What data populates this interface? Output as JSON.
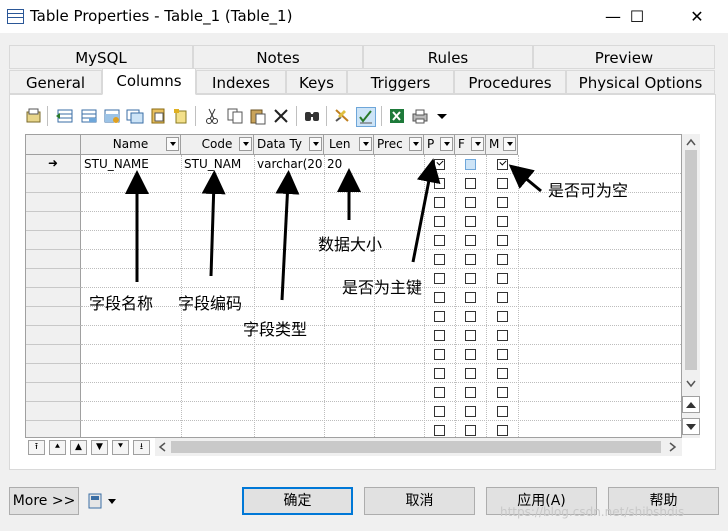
{
  "window": {
    "title": "Table Properties - Table_1 (Table_1)",
    "minimize": "—",
    "maximize": "☐",
    "close": "✕"
  },
  "tabs_row1": [
    "MySQL",
    "Notes",
    "Rules",
    "Preview"
  ],
  "tabs_row2": [
    "General",
    "Columns",
    "Indexes",
    "Keys",
    "Triggers",
    "Procedures",
    "Physical Options"
  ],
  "active_tab": "Columns",
  "toolbar_icons": [
    "properties-icon",
    "insert-row-icon",
    "add-row-icon",
    "add-rows-icon",
    "copy-rows-icon",
    "paste-rows-icon",
    "new-icon",
    "cut-icon",
    "copy-icon",
    "paste-icon",
    "delete-icon",
    "find-icon",
    "filter-icon",
    "customize-columns-icon",
    "excel-icon",
    "print-icon",
    "dropdown-arrow-icon"
  ],
  "columns": {
    "headers": [
      "Name",
      "Code",
      "Data Ty",
      "Len",
      "Prec",
      "P",
      "F",
      "M"
    ],
    "rows": [
      {
        "marker": "➜",
        "name": "STU_NAME",
        "code": "STU_NAM",
        "data_type": "varchar(20",
        "length": "20",
        "precision": "",
        "primary": true,
        "foreign": false,
        "mandatory": true
      }
    ]
  },
  "annotations": {
    "name_field": "字段名称",
    "code_field": "字段编码",
    "type_field": "字段类型",
    "length_field": "数据大小",
    "primary_key": "是否为主键",
    "nullable": "是否可为空"
  },
  "nav_buttons": [
    "⭱",
    "⯅",
    "▲",
    "▼",
    "⯆",
    "⭳"
  ],
  "footer": {
    "more": "More >>",
    "ok": "确定",
    "cancel": "取消",
    "apply": "应用(A)",
    "help": "帮助"
  },
  "watermark": "https://blog.csdn.net/shibshdis",
  "colors": {
    "accent": "#0078d7",
    "selection": "#cde4f7"
  }
}
